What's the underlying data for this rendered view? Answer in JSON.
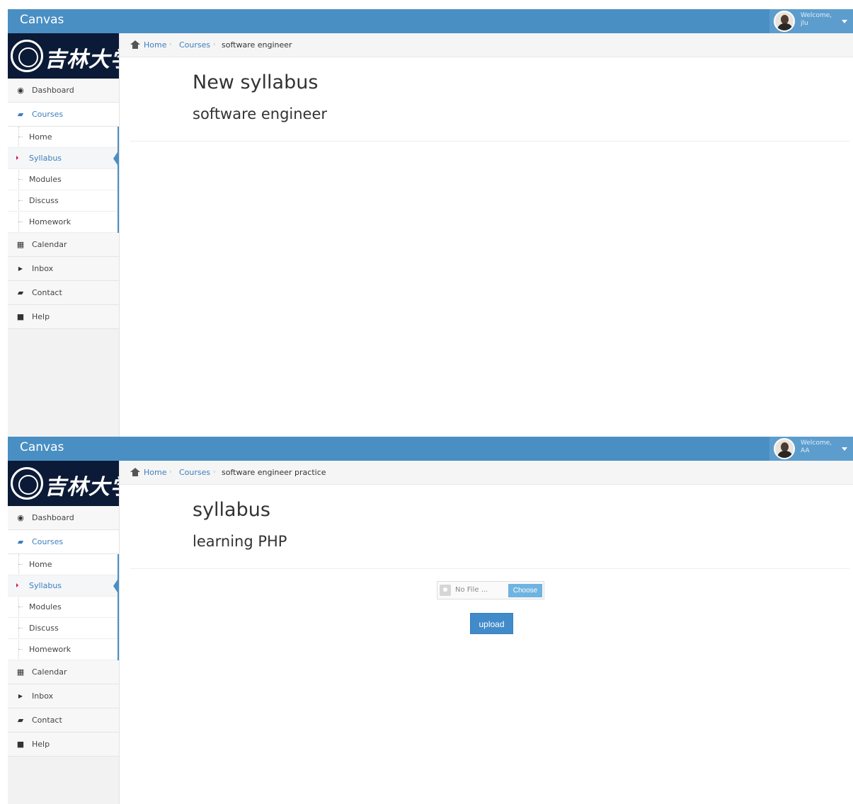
{
  "screens": [
    {
      "app_title": "Canvas",
      "user": {
        "welcome": "Welcome,",
        "name": "jlu"
      },
      "logo_text": "吉林大学",
      "breadcrumb": {
        "home": "Home",
        "courses": "Courses",
        "current": "software engineer"
      },
      "nav": {
        "dashboard": "Dashboard",
        "courses": "Courses",
        "sub": [
          "Home",
          "Syllabus",
          "Modules",
          "Discuss",
          "Homework"
        ],
        "calendar": "Calendar",
        "inbox": "Inbox",
        "contact": "Contact",
        "help": "Help"
      },
      "page_title": "New syllabus",
      "page_subtitle": "software engineer"
    },
    {
      "app_title": "Canvas",
      "user": {
        "welcome": "Welcome,",
        "name": "AA"
      },
      "logo_text": "吉林大学",
      "breadcrumb": {
        "home": "Home",
        "courses": "Courses",
        "current": "software engineer practice"
      },
      "nav": {
        "dashboard": "Dashboard",
        "courses": "Courses",
        "sub": [
          "Home",
          "Syllabus",
          "Modules",
          "Discuss",
          "Homework"
        ],
        "calendar": "Calendar",
        "inbox": "Inbox",
        "contact": "Contact",
        "help": "Help"
      },
      "page_title": "syllabus",
      "page_subtitle": "learning PHP",
      "file_input": {
        "status": "No File ...",
        "choose_label": "Choose"
      },
      "upload_label": "upload"
    }
  ],
  "colors": {
    "topbar": "#4a8fc4",
    "accent": "#3d7fbd",
    "button": "#428bca"
  },
  "icons": [
    "home-icon",
    "dashboard-icon",
    "book-icon",
    "calendar-icon",
    "caret-right-icon",
    "contact-icon",
    "help-icon",
    "caret-down-icon",
    "file-icon"
  ]
}
